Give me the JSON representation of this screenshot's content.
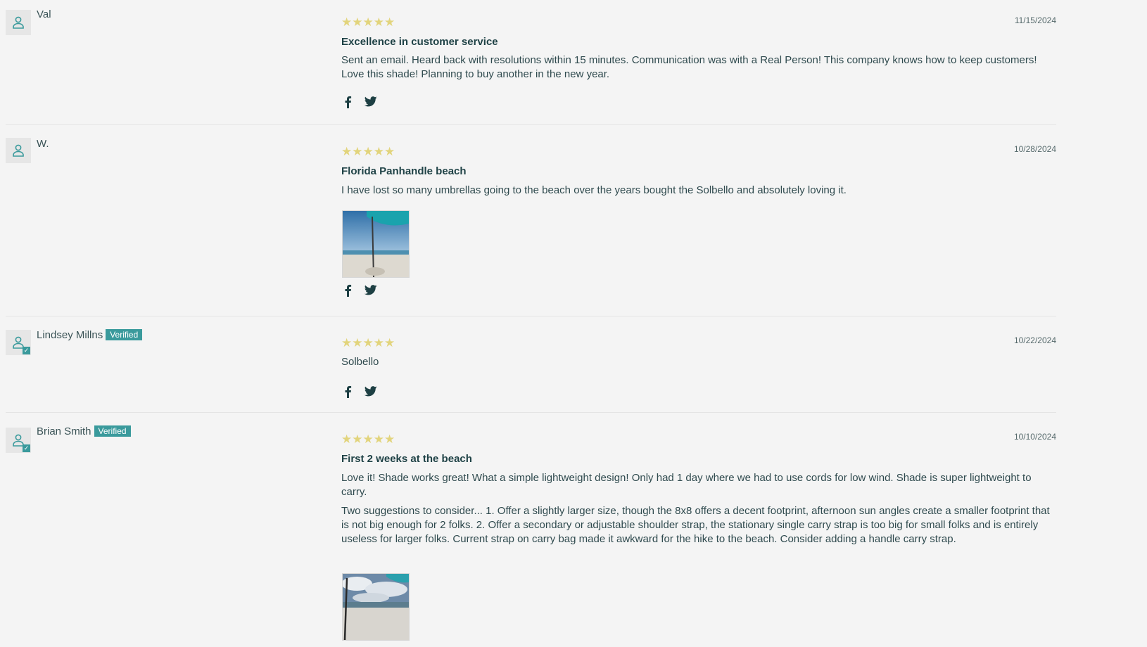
{
  "reviews": [
    {
      "author": "Val",
      "verified": false,
      "rating": 5,
      "date": "11/15/2024",
      "title": "Excellence in customer service",
      "body": [
        "Sent an email. Heard back with resolutions within 15 minutes. Communication was with a Real Person! This company knows how to keep customers! Love this shade! Planning to buy another in the new year."
      ],
      "has_photo": false
    },
    {
      "author": "W.",
      "verified": false,
      "rating": 5,
      "date": "10/28/2024",
      "title": "Florida Panhandle beach",
      "body": [
        "I have lost so many umbrellas going to the beach over the years bought the Solbello and absolutely loving it."
      ],
      "has_photo": true
    },
    {
      "author": "Lindsey Millns",
      "verified": true,
      "verified_label": "Verified",
      "rating": 5,
      "date": "10/22/2024",
      "title": "",
      "body": [
        "Solbello"
      ],
      "has_photo": false
    },
    {
      "author": "Brian Smith",
      "verified": true,
      "verified_label": "Verified",
      "rating": 5,
      "date": "10/10/2024",
      "title": "First 2 weeks at the beach",
      "body": [
        "Love it! Shade works great! What a simple lightweight design! Only had 1 day where we had to use cords for low wind. Shade is super lightweight to carry.",
        "Two suggestions to consider... 1. Offer a slightly larger size, though the 8x8 offers a decent footprint, afternoon sun angles create a smaller footprint that is not big enough for 2 folks. 2. Offer a secondary or adjustable shoulder strap, the stationary single carry strap is too big for small folks and is entirely useless for larger folks. Current strap on carry bag made it awkward for the hike to the beach. Consider adding a handle carry strap."
      ],
      "has_photo": true
    }
  ],
  "icons": {
    "avatar": "user-icon",
    "verified_check": "check-icon",
    "star": "star-icon",
    "facebook": "facebook-icon",
    "twitter": "twitter-icon"
  },
  "colors": {
    "background": "#f4f4f4",
    "accent": "#3a9a9c",
    "star": "#e2d47c",
    "text": "#25464a"
  }
}
